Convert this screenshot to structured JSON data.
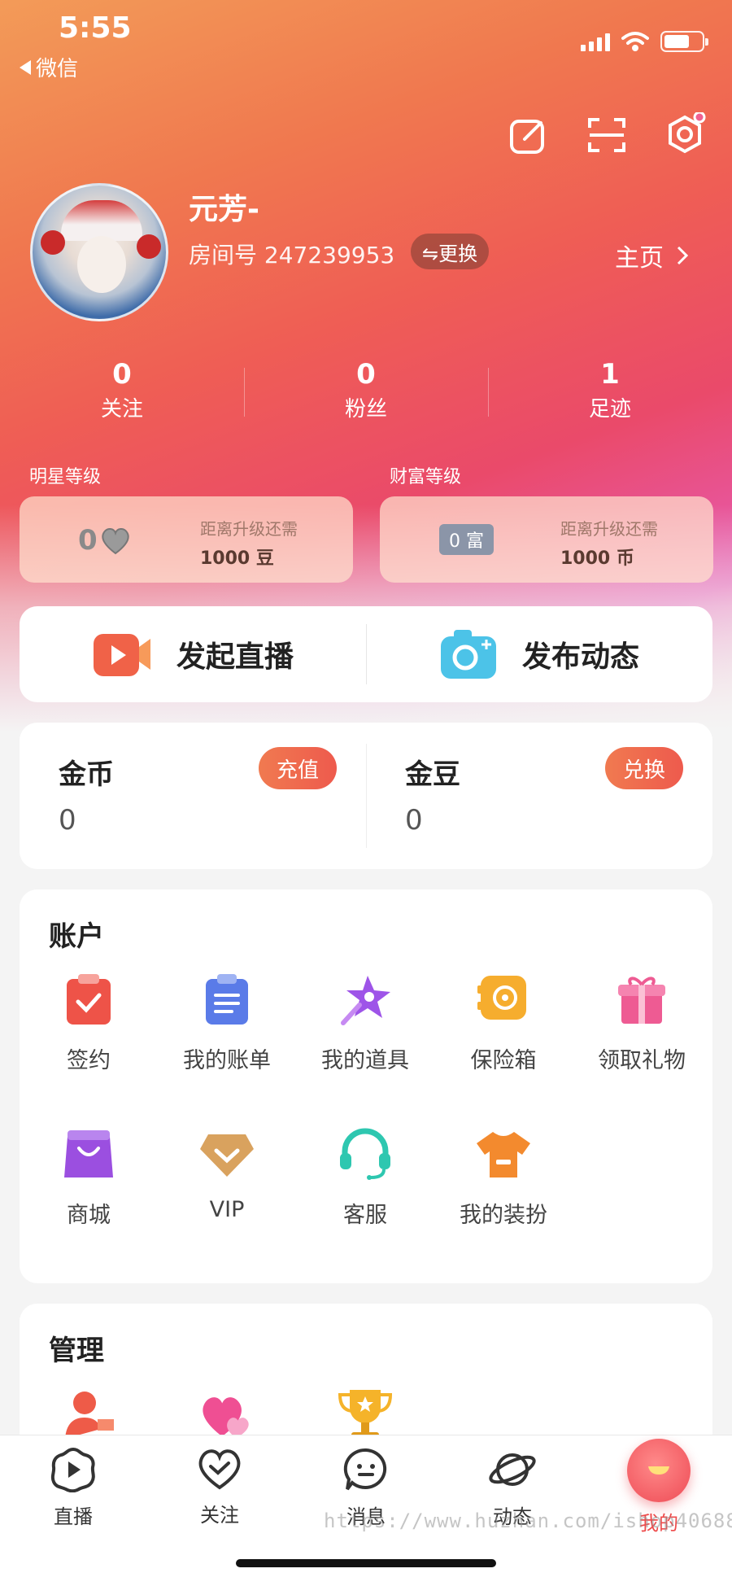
{
  "status": {
    "time": "5:55",
    "back_label": "微信"
  },
  "profile": {
    "nickname": "元芳-",
    "room_label": "房间号 247239953",
    "switch_label": "⇋更换",
    "homepage_label": "主页"
  },
  "stats": [
    {
      "num": "0",
      "label": "关注"
    },
    {
      "num": "0",
      "label": "粉丝"
    },
    {
      "num": "1",
      "label": "足迹"
    }
  ],
  "levels": {
    "star": {
      "title": "明星等级",
      "badge": "0",
      "need": "距离升级还需",
      "amount": "1000 豆"
    },
    "rich": {
      "title": "财富等级",
      "badge": "0 富",
      "need": "距离升级还需",
      "amount": "1000 币"
    }
  },
  "live": {
    "start": "发起直播",
    "post": "发布动态"
  },
  "coins": {
    "gold": {
      "title": "金币",
      "value": "0",
      "action": "充值"
    },
    "bean": {
      "title": "金豆",
      "value": "0",
      "action": "兑换"
    }
  },
  "account": {
    "title": "账户",
    "items": [
      {
        "label": "签约",
        "icon": "contract-icon"
      },
      {
        "label": "我的账单",
        "icon": "bill-icon"
      },
      {
        "label": "我的道具",
        "icon": "wand-icon"
      },
      {
        "label": "保险箱",
        "icon": "safe-icon"
      },
      {
        "label": "领取礼物",
        "icon": "gift-icon"
      },
      {
        "label": "商城",
        "icon": "shop-bag-icon"
      },
      {
        "label": "VIP",
        "icon": "vip-icon"
      },
      {
        "label": "客服",
        "icon": "headset-icon"
      },
      {
        "label": "我的装扮",
        "icon": "tshirt-icon"
      }
    ]
  },
  "management": {
    "title": "管理"
  },
  "tabs": [
    {
      "label": "直播"
    },
    {
      "label": "关注"
    },
    {
      "label": "消息"
    },
    {
      "label": "动态"
    },
    {
      "label": "我的"
    }
  ],
  "watermark": "https://www.huzhan.com/ishop40688"
}
